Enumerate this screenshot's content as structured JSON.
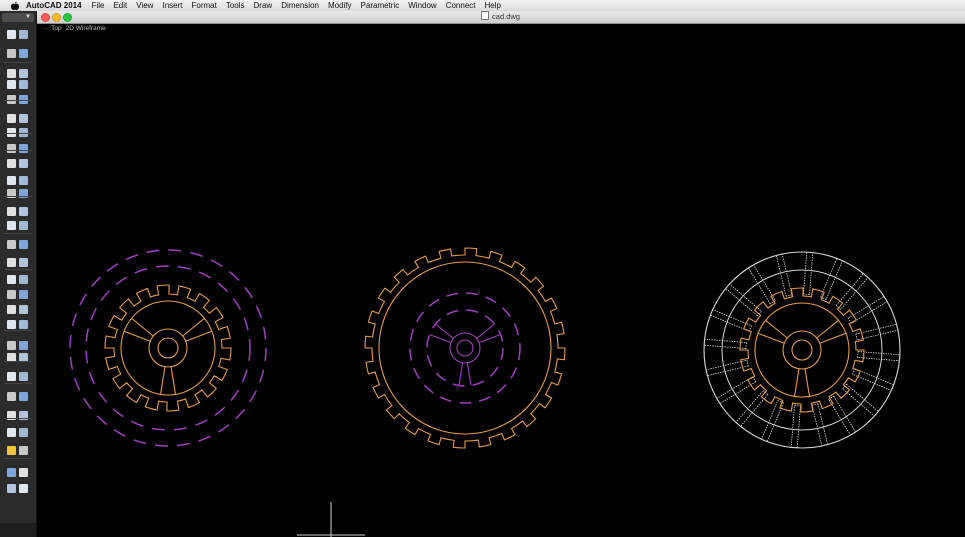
{
  "menubar": {
    "app_name": "AutoCAD 2014",
    "items": [
      "File",
      "Edit",
      "View",
      "Insert",
      "Format",
      "Tools",
      "Draw",
      "Dimension",
      "Modify",
      "Parametric",
      "Window",
      "Connect",
      "Help"
    ]
  },
  "window": {
    "title": "cad.dwg"
  },
  "viewport_controls": {
    "minus": "-",
    "view": "Top",
    "visual_style": "2D Wireframe"
  },
  "colors": {
    "orange": "#e69a4e",
    "magenta": "#a03fc0",
    "white": "#d8d8d8",
    "palette_bg": "#2b2b2b"
  },
  "palette_icons": [
    "select-icon",
    "move-icon",
    "add-icon",
    "undo-icon",
    "redo-icon",
    "cube-icon",
    "box-icon",
    "wedge-icon",
    "sphere-icon",
    "cylinder-icon",
    "extrude-icon",
    "loft-icon",
    "line-icon",
    "arc-icon",
    "circle-icon",
    "rectangle-icon",
    "rotate-icon",
    "mirror-icon",
    "trim-icon",
    "fillet-icon",
    "layer-icon",
    "light-icon",
    "render-icon",
    "dimension-icon",
    "measure-icon",
    "zoom-icon",
    "pan-icon"
  ]
}
